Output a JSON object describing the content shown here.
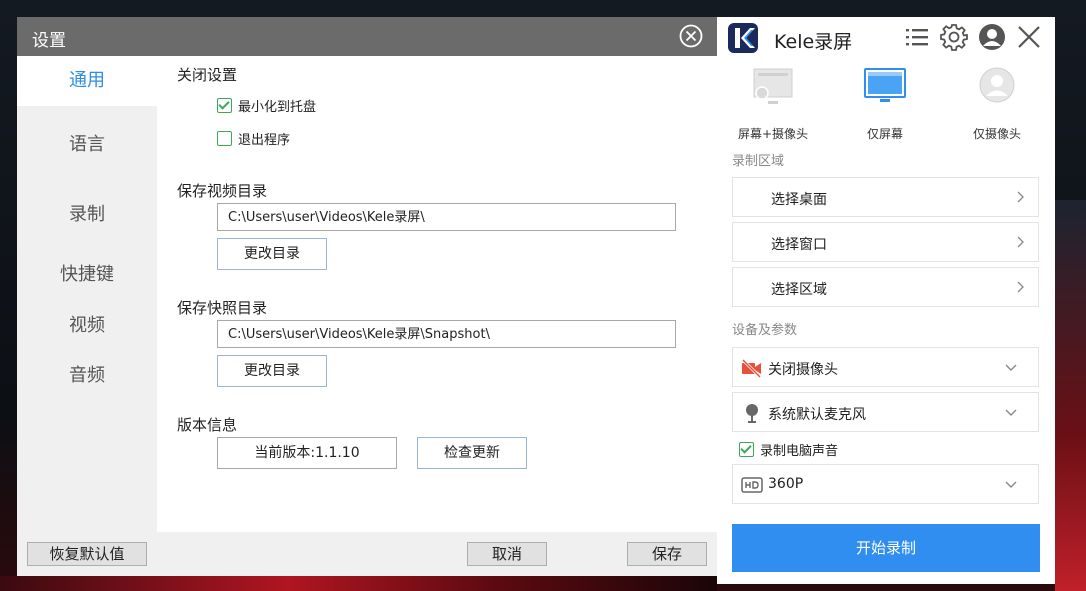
{
  "settings": {
    "title": "设置",
    "nav": [
      "通用",
      "语言",
      "录制",
      "快捷键",
      "视频",
      "音频"
    ],
    "close_settings": {
      "title": "关闭设置",
      "minimize_label": "最小化到托盘",
      "minimize_checked": true,
      "exit_label": "退出程序",
      "exit_checked": false
    },
    "video_dir": {
      "title": "保存视频目录",
      "path": "C:\\Users\\user\\Videos\\Kele录屏\\",
      "change_label": "更改目录"
    },
    "snapshot_dir": {
      "title": "保存快照目录",
      "path": "C:\\Users\\user\\Videos\\Kele录屏\\Snapshot\\",
      "change_label": "更改目录"
    },
    "version": {
      "title": "版本信息",
      "current": "当前版本:1.1.10",
      "check_label": "检查更新"
    },
    "footer": {
      "restore_label": "恢复默认值",
      "cancel_label": "取消",
      "save_label": "保存"
    }
  },
  "kele": {
    "app_name": "Kele录屏",
    "header_icons": [
      "list-icon",
      "gear-icon",
      "user-icon",
      "close-icon"
    ],
    "modes": [
      {
        "label": "屏幕+摄像头",
        "icon": "screen-camera-icon",
        "active": false
      },
      {
        "label": "仅屏幕",
        "icon": "screen-icon",
        "active": true
      },
      {
        "label": "仅摄像头",
        "icon": "camera-icon",
        "active": false
      }
    ],
    "record_area": {
      "title": "录制区域",
      "items": [
        "选择桌面",
        "选择窗口",
        "选择区域"
      ]
    },
    "devices": {
      "title": "设备及参数",
      "camera": "关闭摄像头",
      "mic": "系统默认麦克风",
      "record_sound_label": "录制电脑声音",
      "record_sound_checked": true,
      "quality": "360P"
    },
    "start_label": "开始录制",
    "colors": {
      "accent": "#2f8ef0",
      "camera_off": "#e8503a",
      "check": "#3aaa5a"
    }
  }
}
